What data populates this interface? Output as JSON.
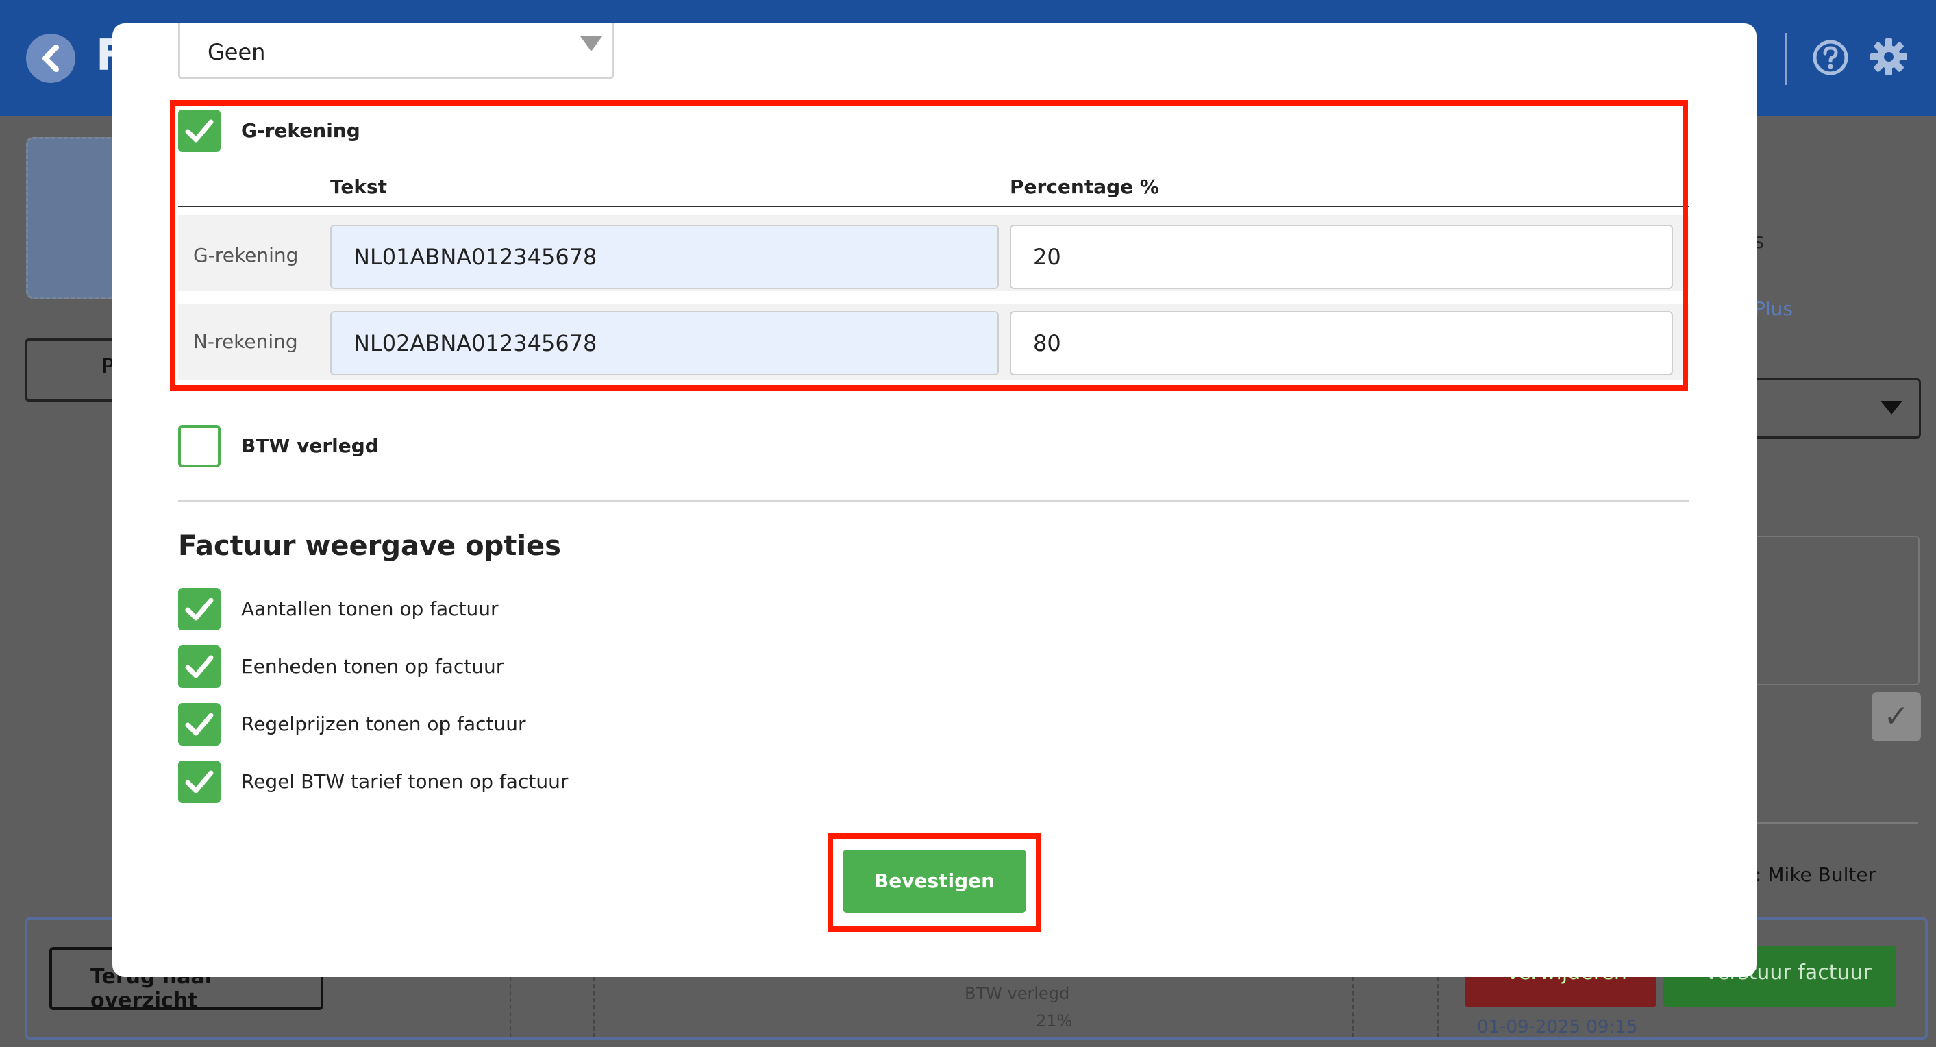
{
  "app": {
    "title_initial": "F",
    "icons": {
      "back": "chevron-left-icon",
      "help": "help-circle-icon",
      "settings": "gear-icon"
    }
  },
  "background": {
    "outline_button_initial": "P",
    "right_text": "s",
    "plus_link": "Plus",
    "author_name": ": Mike Bulter",
    "back_button": "Terug naar overzicht",
    "delete_button": "Verwijderen",
    "send_button": "Verstuur factuur",
    "btw_label": "BTW verlegd",
    "btw_percent": "21%",
    "date": "01-09-2025 09:15"
  },
  "modal": {
    "select_value": "Geen",
    "g_rekening": {
      "checkbox_label": "G-rekening",
      "checked": true,
      "header_text": "Tekst",
      "header_percentage": "Percentage %",
      "rows": [
        {
          "label": "G-rekening",
          "value": "NL01ABNA012345678",
          "percentage": "20"
        },
        {
          "label": "N-rekening",
          "value": "NL02ABNA012345678",
          "percentage": "80"
        }
      ]
    },
    "btw_verlegd": {
      "label": "BTW verlegd",
      "checked": false
    },
    "section_title": "Factuur weergave opties",
    "options": [
      {
        "label": "Aantallen tonen op factuur",
        "checked": true
      },
      {
        "label": "Eenheden tonen op factuur",
        "checked": true
      },
      {
        "label": "Regelprijzen tonen op factuur",
        "checked": true
      },
      {
        "label": "Regel BTW tarief tonen op factuur",
        "checked": true
      }
    ],
    "confirm_button": "Bevestigen"
  },
  "colors": {
    "brand_blue": "#1b4f9c",
    "accent_green": "#4caf50",
    "highlight_red": "#ff1a00"
  }
}
